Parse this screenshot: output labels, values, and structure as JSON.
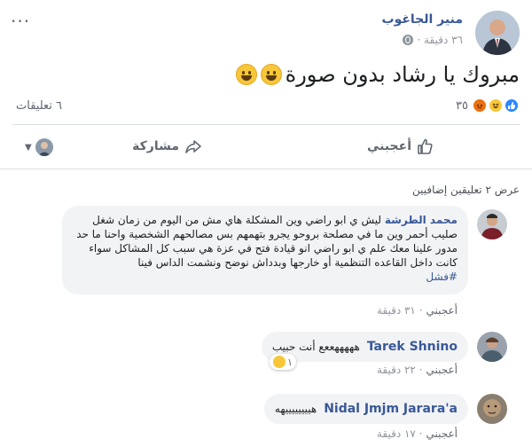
{
  "post": {
    "author": "منير الجاغوب",
    "time": "٣٦ دقيقة ·",
    "text": "مبروك يا رشاد بدون صورة",
    "reactions_count": "٣٥",
    "comments_count": "٦ تعليقات"
  },
  "actions": {
    "like": "أعجبني",
    "share": "مشاركة"
  },
  "view_more": "عرض ٢ تعليقين إضافيين",
  "comments": [
    {
      "name": "محمد الطرشة",
      "text": "ليش ي ابو راضي وين المشكلة هاي مش من اليوم من زمان شغل صليب أحمر وين ما في مصلحة بروحو يجرو بتهمهم بس مصالحهم الشخصية واحنا ما حد مدور علينا معك علم ي ابو راضي انو قيادة فتح في عزة هي سبب كل المشاكل سواء كانت داخل القاعده التنظمية أو خارجها وبدداش نوضح ونشمت الداس فينا",
      "hashtag": "#فشل",
      "like": "أعجبني",
      "time": "· ٣١ دقيقة"
    },
    {
      "name": "Tarek Shnino",
      "text": "هههههععع أنت حبيب",
      "like": "أعجبني",
      "time": "· ٢٢ دقيقة",
      "react_count": "١"
    },
    {
      "name": "Nidal Jmjm Jarara'a",
      "text": "هييييييييهه",
      "like": "أعجبني",
      "time": "· ١٧ دقيقة"
    }
  ]
}
